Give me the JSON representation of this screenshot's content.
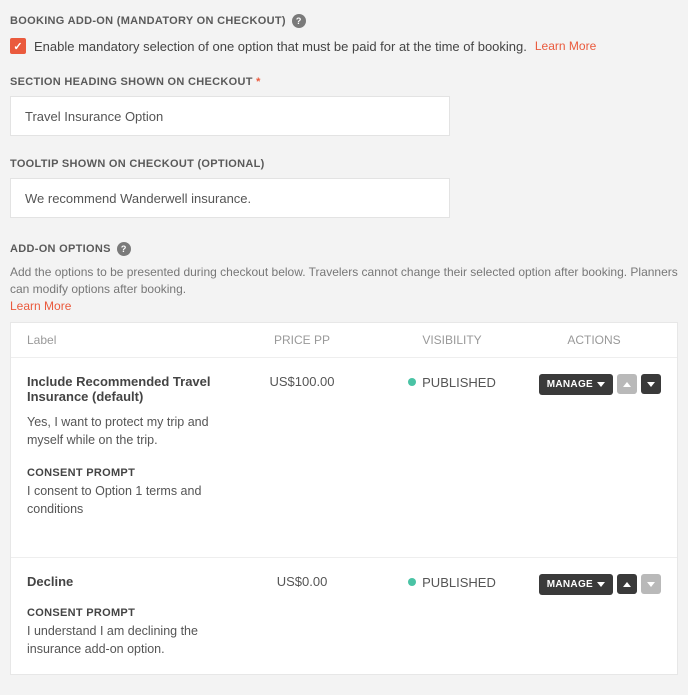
{
  "booking_addon": {
    "heading": "BOOKING ADD-ON (MANDATORY ON CHECKOUT)",
    "checkbox_label": "Enable mandatory selection of one option that must be paid for at the time of booking.",
    "learn_more": "Learn More"
  },
  "section_heading": {
    "label": "SECTION HEADING SHOWN ON CHECKOUT",
    "required_mark": "*",
    "value": "Travel Insurance Option"
  },
  "tooltip_field": {
    "label": "TOOLTIP SHOWN ON CHECKOUT (OPTIONAL)",
    "value": "We recommend Wanderwell insurance."
  },
  "addon_options": {
    "heading": "ADD-ON OPTIONS",
    "description": "Add the options to be presented during checkout below. Travelers cannot change their selected option after booking. Planners can modify options after booking.",
    "learn_more": "Learn More"
  },
  "table": {
    "headers": {
      "label": "Label",
      "price": "PRICE PP",
      "visibility": "VISIBILITY",
      "actions": "ACTIONS"
    },
    "rows": [
      {
        "title": "Include Recommended Travel Insurance (default)",
        "desc": "Yes, I want to protect my trip and myself while on the trip.",
        "consent_heading": "CONSENT PROMPT",
        "consent_text": "I consent to Option 1 terms and conditions",
        "price": "US$100.00",
        "visibility": "PUBLISHED",
        "manage": "MANAGE",
        "up_active": false,
        "down_active": true
      },
      {
        "title": "Decline",
        "desc": "",
        "consent_heading": "CONSENT PROMPT",
        "consent_text": "I understand I am declining the insurance add-on option.",
        "price": "US$0.00",
        "visibility": "PUBLISHED",
        "manage": "MANAGE",
        "up_active": true,
        "down_active": false
      }
    ]
  }
}
